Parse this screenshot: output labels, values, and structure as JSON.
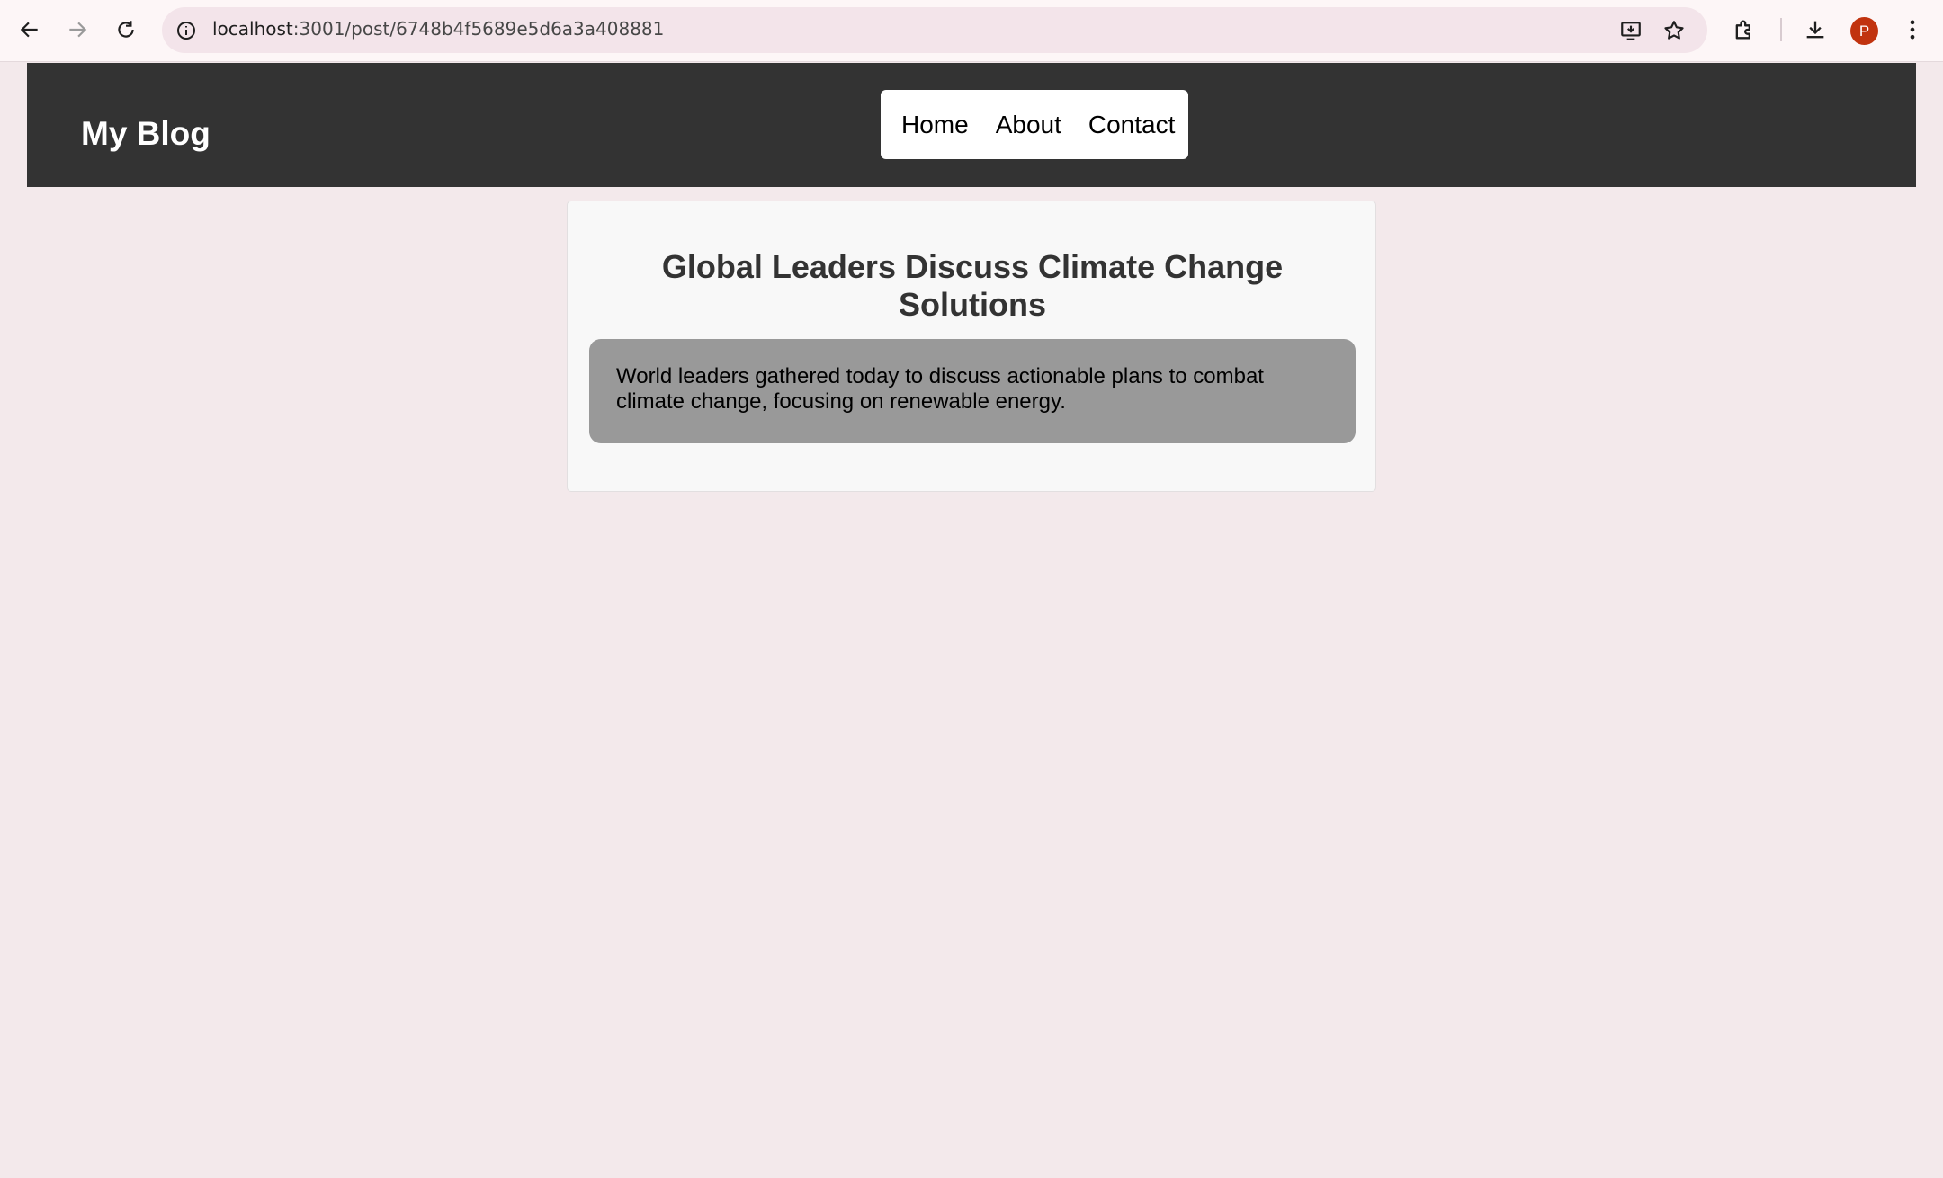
{
  "browser": {
    "url_host": "localhost",
    "url_path": ":3001/post/6748b4f5689e5d6a3a408881",
    "profile_initial": "P",
    "icons": {
      "back": "back-arrow-icon",
      "forward": "forward-arrow-icon",
      "reload": "reload-icon",
      "site_info": "site-info-icon",
      "install": "install-app-icon",
      "bookmark": "star-icon",
      "extensions": "puzzle-icon",
      "downloads": "download-icon",
      "menu": "kebab-menu-icon"
    }
  },
  "site": {
    "logo": "My Blog",
    "nav": [
      "Home",
      "About",
      "Contact"
    ]
  },
  "post": {
    "title": "Global Leaders Discuss Climate Change Solutions",
    "content": "World leaders gathered today to discuss actionable plans to combat climate change, focusing on renewable energy."
  },
  "colors": {
    "page_background": "#f3e9eb",
    "header_background": "#333333",
    "card_background": "#f8f8f8",
    "content_background": "#999999",
    "avatar": "#c1330f"
  }
}
